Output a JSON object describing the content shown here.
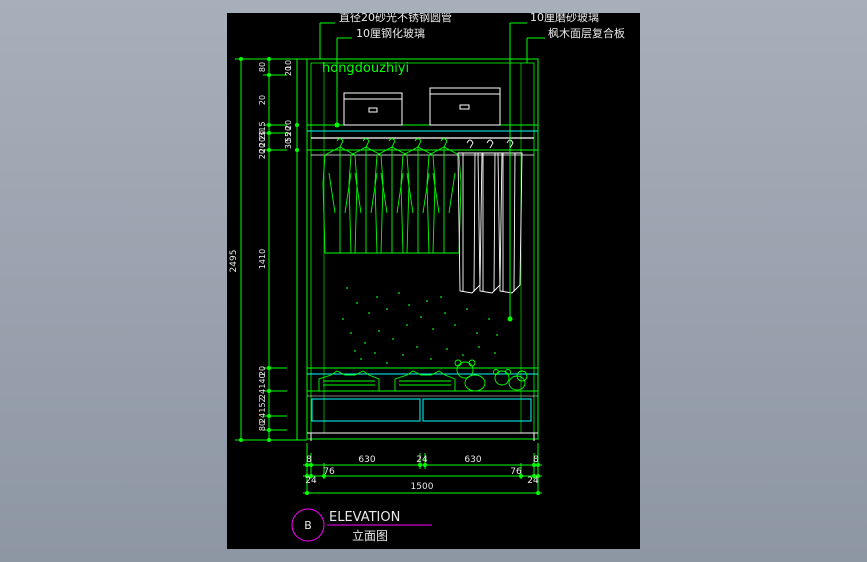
{
  "annotations": {
    "pipe": "直径20砂光不锈钢圆管",
    "tempered_glass": "10厘钢化玻璃",
    "frosted_glass": "10厘磨砂玻璃",
    "maple_board": "枫木面层复合板",
    "watermark": "hongdouzhiyi"
  },
  "dimensions": {
    "left_total": "2495",
    "left_segments": [
      "80",
      "20",
      "315",
      "20",
      "20",
      "20",
      "20",
      "1410",
      "20",
      "140",
      "24",
      "152",
      "24",
      "80"
    ],
    "right_segments": [
      "10",
      "20",
      "20",
      "20",
      "55",
      "30"
    ],
    "top_bottom_row": [
      "8",
      "630",
      "24",
      "630",
      "8"
    ],
    "lower_row": [
      "24",
      "76",
      "76",
      "24"
    ],
    "overall_width": "1500"
  },
  "title": {
    "badge": "B",
    "main": "ELEVATION",
    "sub": "立面图"
  },
  "colors": {
    "background": "#000000",
    "frame": "#00ff00",
    "drawing": "#ffffff",
    "shelf": "#00ffff",
    "title_line": "#ff00ff",
    "outer_bg": "#9aa2ad"
  }
}
